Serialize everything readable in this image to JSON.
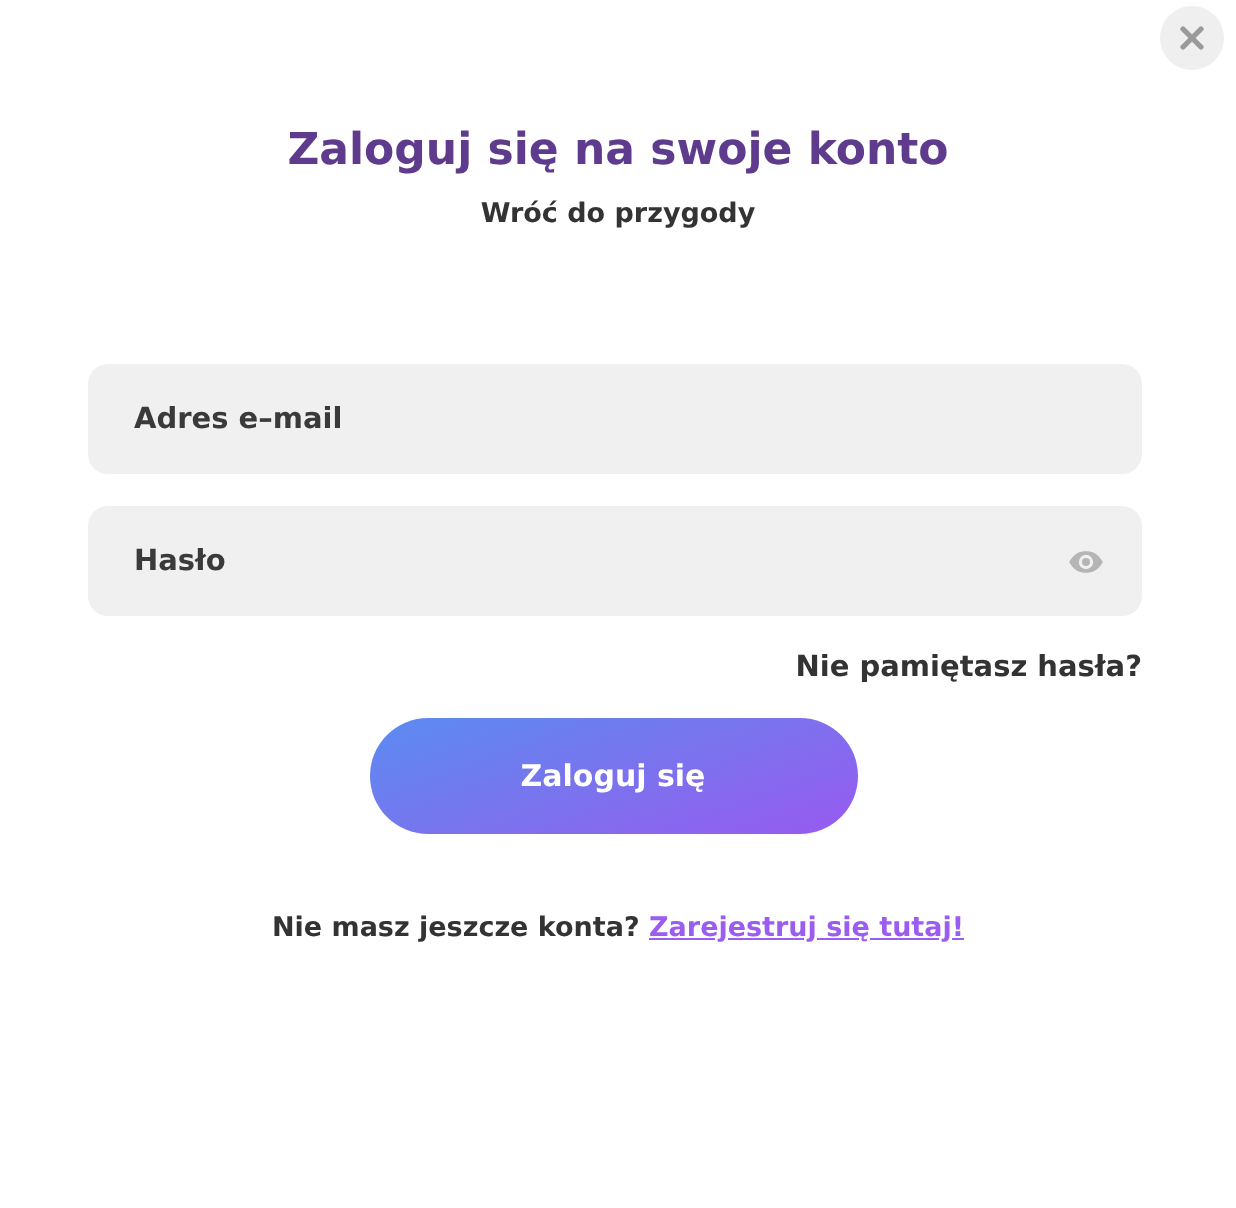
{
  "header": {
    "title": "Zaloguj się na swoje konto",
    "subtitle": "Wróć do przygody"
  },
  "fields": [
    {
      "kind": "email",
      "placeholder": "Adres e–mail"
    },
    {
      "kind": "password",
      "placeholder": "Hasło"
    }
  ],
  "forgot_link": "Nie pamiętasz hasła?",
  "submit_button": "Zaloguj się",
  "signup": {
    "text": "Nie masz jeszcze konta?",
    "link": "Zarejestruj się tutaj!"
  }
}
